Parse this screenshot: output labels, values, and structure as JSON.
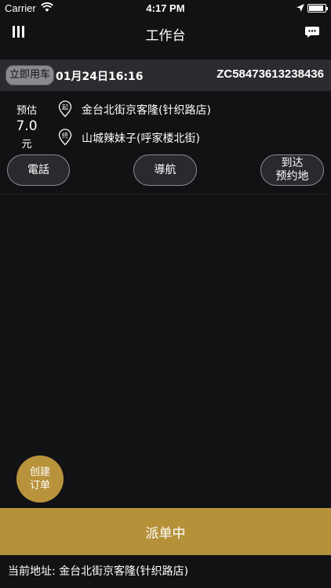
{
  "status_bar": {
    "carrier": "Carrier",
    "time": "4:17 PM",
    "battery_level": 0.9
  },
  "nav": {
    "title": "工作台"
  },
  "order": {
    "type_label": "立即用车",
    "datetime": "01月24日16:16",
    "order_no": "ZC58473613238436"
  },
  "estimate": {
    "label": "预估",
    "price": "7.0",
    "unit": "元"
  },
  "route": {
    "start_badge": "起",
    "start_address": "金台北街京客隆(针织路店)",
    "end_badge": "终",
    "end_address": "山城辣妹子(呼家楼北街)"
  },
  "actions": {
    "call_label": "電話",
    "navigate_label": "導航",
    "arrive_label_line1": "到达",
    "arrive_label_line2": "预约地"
  },
  "create_order": {
    "line1": "创建",
    "line2": "订单"
  },
  "dispatch": {
    "label": "派单中"
  },
  "current_address": {
    "label": "当前地址:",
    "value": "金台北街京客隆(针织路店)"
  },
  "colors": {
    "accent": "#b5923a",
    "background": "#121215",
    "order_bar": "#2c2c30"
  }
}
